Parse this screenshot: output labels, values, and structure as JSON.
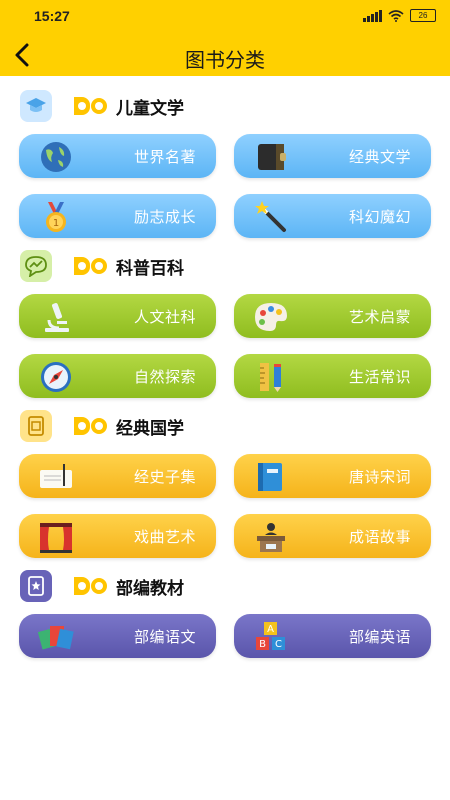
{
  "status": {
    "time": "15:27",
    "battery": "26"
  },
  "nav": {
    "title": "图书分类"
  },
  "sections": [
    {
      "title": "儿童文学",
      "items": [
        "世界名著",
        "经典文学",
        "励志成长",
        "科幻魔幻"
      ]
    },
    {
      "title": "科普百科",
      "items": [
        "人文社科",
        "艺术启蒙",
        "自然探索",
        "生活常识"
      ]
    },
    {
      "title": "经典国学",
      "items": [
        "经史子集",
        "唐诗宋词",
        "戏曲艺术",
        "成语故事"
      ]
    },
    {
      "title": "部编教材",
      "items": [
        "部编语文",
        "部编英语"
      ]
    }
  ],
  "colors": {
    "accent": "#FFD000",
    "blue": "#6cc0fa",
    "green": "#9cc52a",
    "yellow": "#f8c12a",
    "purple": "#6561b8"
  },
  "icons": [
    "graduation-cap-icon",
    "chart-bubble-icon",
    "book-frame-icon",
    "star-book-icon"
  ]
}
